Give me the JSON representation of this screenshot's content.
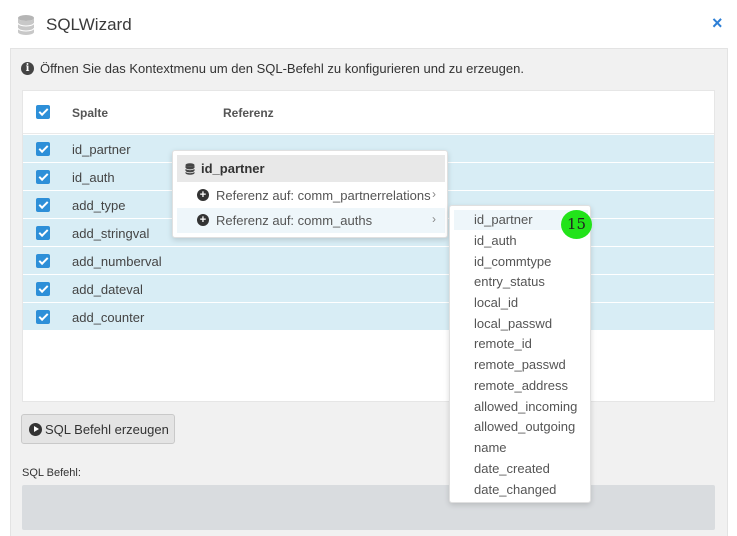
{
  "window": {
    "title": "SQLWizard",
    "close_glyph": "×",
    "accent_color": "#2d8fd8"
  },
  "info": {
    "text": "Öffnen Sie das Kontextmenu um den SQL-Befehl zu konfigurieren und zu erzeugen."
  },
  "table": {
    "headers": {
      "column": "Spalte",
      "reference": "Referenz"
    },
    "header_checked": true,
    "rows": [
      {
        "column": "id_partner",
        "checked": true
      },
      {
        "column": "id_auth",
        "checked": true
      },
      {
        "column": "add_type",
        "checked": true
      },
      {
        "column": "add_stringval",
        "checked": true
      },
      {
        "column": "add_numberval",
        "checked": true
      },
      {
        "column": "add_dateval",
        "checked": true
      },
      {
        "column": "add_counter",
        "checked": true
      }
    ]
  },
  "context_menu": {
    "title": "id_partner",
    "items": [
      {
        "label": "Referenz auf: comm_partnerrelations"
      },
      {
        "label": "Referenz auf: comm_auths"
      }
    ]
  },
  "submenu": {
    "items": [
      "id_partner",
      "id_auth",
      "id_commtype",
      "entry_status",
      "local_id",
      "local_passwd",
      "remote_id",
      "remote_passwd",
      "remote_address",
      "allowed_incoming",
      "allowed_outgoing",
      "name",
      "date_created",
      "date_changed"
    ]
  },
  "badge": {
    "label": "15"
  },
  "actions": {
    "generate_label": "SQL Befehl erzeugen"
  },
  "sql": {
    "label": "SQL Befehl:",
    "value": ""
  }
}
